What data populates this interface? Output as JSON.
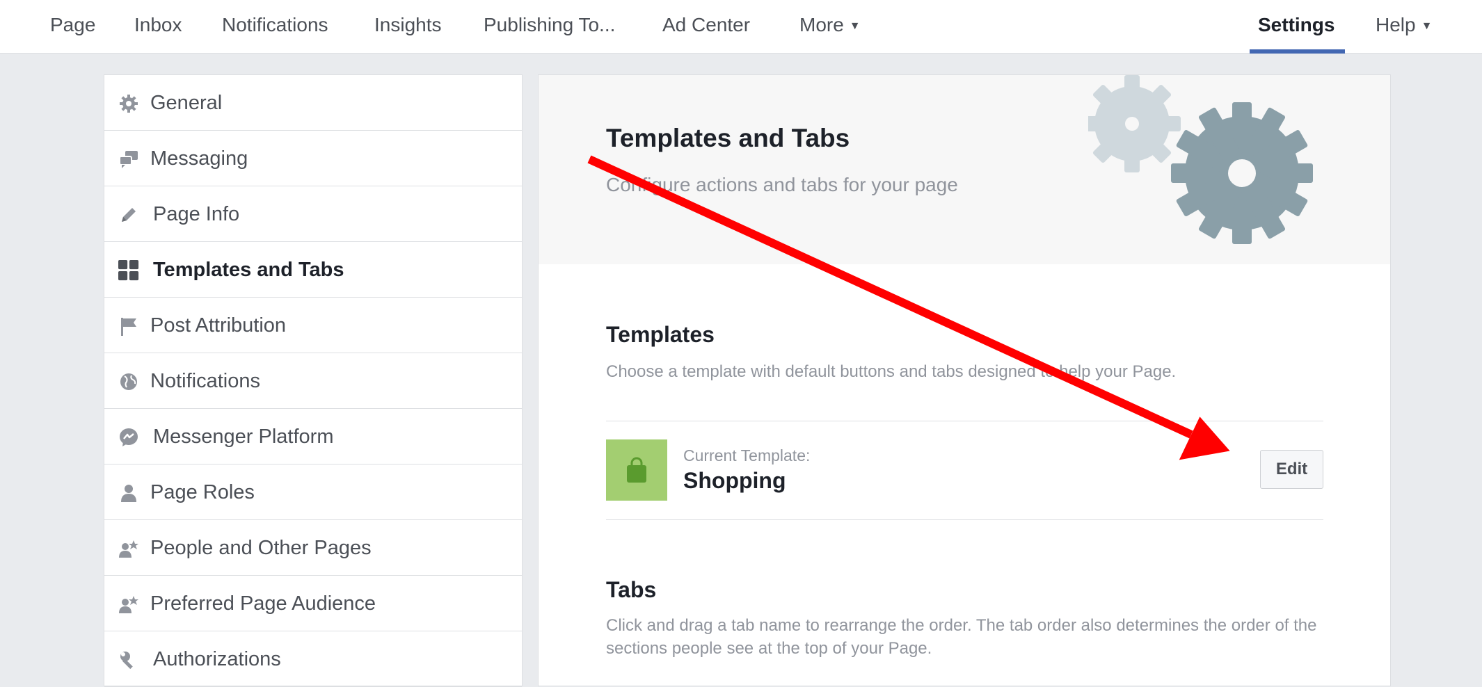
{
  "topnav": {
    "items": [
      {
        "label": "Page"
      },
      {
        "label": "Inbox"
      },
      {
        "label": "Notifications"
      },
      {
        "label": "Insights"
      },
      {
        "label": "Publishing To..."
      },
      {
        "label": "Ad Center"
      },
      {
        "label": "More"
      },
      {
        "label": "Settings",
        "active": true
      },
      {
        "label": "Help"
      }
    ]
  },
  "sidebar": {
    "items": [
      {
        "label": "General",
        "icon": "gear-icon"
      },
      {
        "label": "Messaging",
        "icon": "chat-bubbles-icon"
      },
      {
        "label": "Page Info",
        "icon": "pencil-icon"
      },
      {
        "label": "Templates and Tabs",
        "icon": "grid-icon",
        "active": true
      },
      {
        "label": "Post Attribution",
        "icon": "flag-icon"
      },
      {
        "label": "Notifications",
        "icon": "globe-icon"
      },
      {
        "label": "Messenger Platform",
        "icon": "messenger-icon"
      },
      {
        "label": "Page Roles",
        "icon": "person-icon"
      },
      {
        "label": "People and Other Pages",
        "icon": "person-star-icon"
      },
      {
        "label": "Preferred Page Audience",
        "icon": "person-star-icon"
      },
      {
        "label": "Authorizations",
        "icon": "wrench-icon"
      }
    ]
  },
  "main": {
    "title": "Templates and Tabs",
    "subtitle": "Configure actions and tabs for your page",
    "templates": {
      "heading": "Templates",
      "description": "Choose a template with default buttons and tabs designed to help your Page.",
      "current_label": "Current Template:",
      "current_name": "Shopping",
      "edit_label": "Edit"
    },
    "tabs": {
      "heading": "Tabs",
      "description": "Click and drag a tab name to rearrange the order. The tab order also determines the order of the sections people see at the top of your Page."
    }
  },
  "colors": {
    "accent": "#4267b2",
    "arrow": "#ff0000",
    "template_thumb": "#a3ce71",
    "gear_light": "#cfd8dd",
    "gear_dark": "#8a9fa8"
  }
}
